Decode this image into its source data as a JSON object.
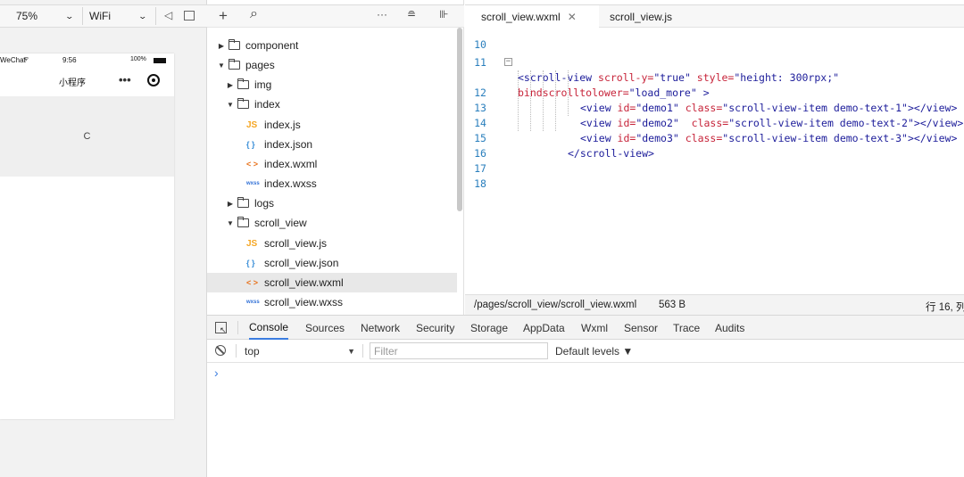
{
  "simulator": {
    "zoom": "75%",
    "network": "WiFi",
    "status": {
      "carrier": "WeChat",
      "time": "9:56",
      "battery": "100%"
    },
    "nav_title": "小程序",
    "nav_more": "•••",
    "content_text": "C"
  },
  "file_tree": {
    "items": [
      {
        "label": "component",
        "kind": "folder",
        "expanded": false
      },
      {
        "label": "pages",
        "kind": "folder",
        "expanded": true
      },
      {
        "label": "img",
        "kind": "folder",
        "expanded": false
      },
      {
        "label": "index",
        "kind": "folder",
        "expanded": true
      },
      {
        "label": "index.js",
        "kind": "js",
        "icon_text": "JS"
      },
      {
        "label": "index.json",
        "kind": "json",
        "icon_text": "{ }"
      },
      {
        "label": "index.wxml",
        "kind": "wxml",
        "icon_text": "< >"
      },
      {
        "label": "index.wxss",
        "kind": "wxss",
        "icon_text": "wxss"
      },
      {
        "label": "logs",
        "kind": "folder",
        "expanded": false
      },
      {
        "label": "scroll_view",
        "kind": "folder",
        "expanded": true
      },
      {
        "label": "scroll_view.js",
        "kind": "js",
        "icon_text": "JS"
      },
      {
        "label": "scroll_view.json",
        "kind": "json",
        "icon_text": "{ }"
      },
      {
        "label": "scroll_view.wxml",
        "kind": "wxml",
        "icon_text": "< >",
        "selected": true
      },
      {
        "label": "scroll_view.wxss",
        "kind": "wxss",
        "icon_text": "wxss"
      }
    ],
    "toolbar": {
      "add": "+",
      "search": "⌕",
      "more": "···"
    }
  },
  "editor": {
    "tabs": [
      {
        "label": "scroll_view.wxml",
        "active": true
      },
      {
        "label": "scroll_view.js",
        "active": false
      }
    ],
    "line_numbers": [
      "10",
      "11",
      "",
      "12",
      "13",
      "14",
      "15",
      "16",
      "17",
      "18"
    ],
    "code": {
      "l11_a": "<scroll-view ",
      "l11_attr1": "scroll-y=",
      "l11_val1": "\"true\" ",
      "l11_attr2": "style=",
      "l11_val2": "\"height: 300rpx;\"",
      "l11b_attr": "bindscrolltolower=",
      "l11b_val": "\"load_more\" >",
      "l12_tag": "<view ",
      "l12_id": "id=",
      "l12_idv": "\"demo1\" ",
      "l12_cls": "class=",
      "l12_clsv": "\"scroll-view-item demo-text-1\"></view>",
      "l13_tag": "<view ",
      "l13_id": "id=",
      "l13_idv": "\"demo2\"  ",
      "l13_cls": "class=",
      "l13_clsv": "\"scroll-view-item demo-text-2\"></view>",
      "l14_tag": "<view ",
      "l14_id": "id=",
      "l14_idv": "\"demo3\" ",
      "l14_cls": "class=",
      "l14_clsv": "\"scroll-view-item demo-text-3\"></view>",
      "l15": "</scroll-view>"
    },
    "status": {
      "path": "/pages/scroll_view/scroll_view.wxml",
      "size": "563 B",
      "cursor": "行 16, 列"
    }
  },
  "devtools": {
    "tabs": [
      "Console",
      "Sources",
      "Network",
      "Security",
      "Storage",
      "AppData",
      "Wxml",
      "Sensor",
      "Trace",
      "Audits"
    ],
    "active_tab": "Console",
    "context": "top",
    "filter_placeholder": "Filter",
    "levels": "Default levels ▼",
    "prompt": "›"
  },
  "colors": {
    "accent": "#3b7de0",
    "line_number": "#2a7fbd",
    "attr": "#c7243a",
    "tag": "#1c1c9a"
  }
}
